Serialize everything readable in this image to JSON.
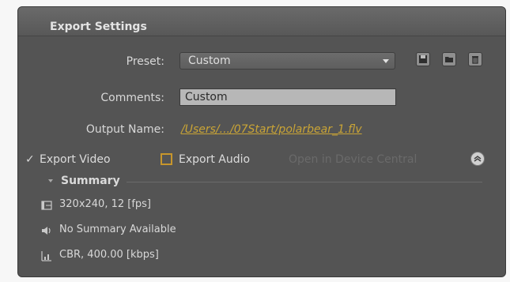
{
  "panel": {
    "title": "Export Settings"
  },
  "preset": {
    "label": "Preset:",
    "value": "Custom"
  },
  "preset_icons": [
    "save-preset-icon",
    "import-preset-icon",
    "delete-preset-icon"
  ],
  "comments": {
    "label": "Comments:",
    "value": "Custom"
  },
  "output": {
    "label": "Output Name:",
    "value": "/Users/.../07Start/polarbear_1.flv"
  },
  "options": {
    "export_video": {
      "label": "Export Video",
      "checked": true
    },
    "export_audio": {
      "label": "Export Audio",
      "checked": false
    },
    "open_device": {
      "label": "Open in Device Central",
      "enabled": false
    }
  },
  "summary": {
    "title": "Summary",
    "video": "320x240, 12 [fps]",
    "audio": "No Summary Available",
    "bitrate": "CBR, 400.00 [kbps]"
  },
  "colors": {
    "panel_bg": "#545454",
    "link": "#c9a436",
    "checkbox_accent": "#c7962c"
  }
}
